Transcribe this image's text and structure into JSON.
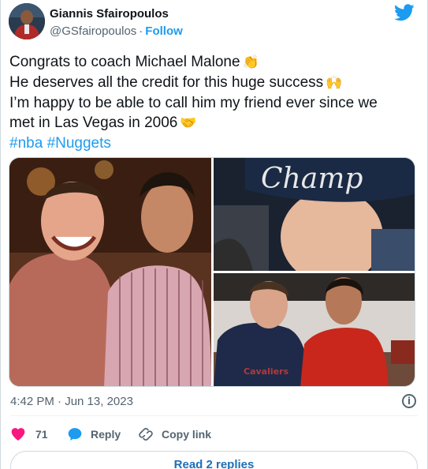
{
  "author": {
    "name": "Giannis Sfairopoulos",
    "handle": "@GSfairopoulos",
    "separator": "·",
    "follow_label": "Follow"
  },
  "tweet": {
    "lines": [
      "Congrats to coach Michael Malone",
      "He deserves all the credit for this huge success",
      "I’m happy to be able to call him my friend ever since we",
      "met in Las Vegas in 2006"
    ],
    "emojis": {
      "line1": "👏",
      "line2": "🙌",
      "line4": "🤝"
    },
    "hashtags": [
      "#nba",
      "#Nuggets"
    ],
    "timestamp": "4:42 PM · Jun 13, 2023"
  },
  "photo_text": {
    "cap_text": "Champ",
    "shirt_text": "Cavaliers"
  },
  "engagement": {
    "likes": "71",
    "reply_label": "Reply",
    "copy_link_label": "Copy link"
  },
  "read_replies_label": "Read 2 replies",
  "colors": {
    "accent": "#1d9bf0",
    "like": "#f91880",
    "secondary_text": "#536471",
    "border": "#cfd9de"
  },
  "icons": {
    "brand": "twitter-bird-icon",
    "like": "heart-icon",
    "reply": "speech-bubble-icon",
    "copy": "link-icon",
    "info": "info-icon"
  }
}
